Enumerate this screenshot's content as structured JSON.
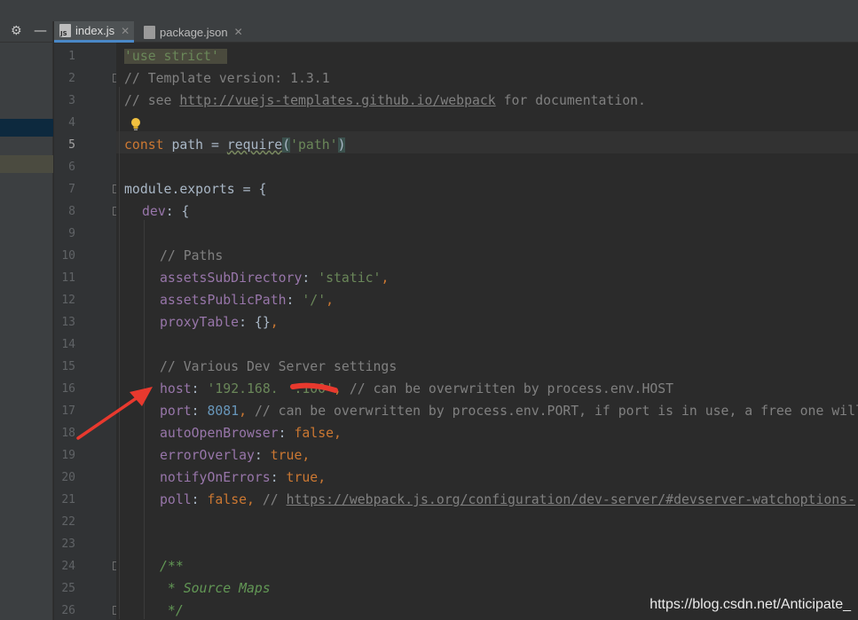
{
  "tabs": [
    {
      "label": "index.js",
      "active": true
    },
    {
      "label": "package.json",
      "active": false
    }
  ],
  "icons": {
    "settings": "gear-icon",
    "collapse": "minus-icon",
    "tab_close": "close-icon",
    "intention": "lightbulb-icon"
  },
  "gutter": {
    "line_numbers": [
      "1",
      "2",
      "3",
      "4",
      "5",
      "6",
      "7",
      "8",
      "9",
      "10",
      "11",
      "12",
      "13",
      "14",
      "15",
      "16",
      "17",
      "18",
      "19",
      "20",
      "21",
      "22",
      "23",
      "24",
      "25",
      "26"
    ],
    "current_line": 5
  },
  "code": {
    "l1": {
      "s": "'use strict'"
    },
    "l2": {
      "c": "// Template version: 1.3.1"
    },
    "l3": {
      "c1": "// see ",
      "url": "http://vuejs-templates.github.io/webpack",
      "c2": " for documentation."
    },
    "l5": {
      "kw": "const",
      "t1": " path = ",
      "fn": "require",
      "p1": "(",
      "s": "'path'",
      "p2": ")"
    },
    "l7": {
      "t": "module.exports = {"
    },
    "l8": {
      "f": "dev",
      "t": ": {"
    },
    "l10": {
      "c": "// Paths"
    },
    "l11": {
      "f": "assetsSubDirectory",
      "t": ": ",
      "s": "'static'",
      "k": ","
    },
    "l12": {
      "f": "assetsPublicPath",
      "t": ": ",
      "s": "'/'",
      "k": ","
    },
    "l13": {
      "f": "proxyTable",
      "t": ": {}",
      "k": ","
    },
    "l15": {
      "c": "// Various Dev Server settings"
    },
    "l16": {
      "f": "host",
      "t": ": ",
      "s": "'192.168.  .100'",
      "k": ",",
      "c": " // can be overwritten by process.env.HOST"
    },
    "l17": {
      "f": "port",
      "t": ": ",
      "n": "8081",
      "k": ",",
      "c": " // can be overwritten by process.env.PORT, if port is in use, a free one will be determined"
    },
    "l18": {
      "f": "autoOpenBrowser",
      "t": ": ",
      "b": "false",
      "k": ","
    },
    "l19": {
      "f": "errorOverlay",
      "t": ": ",
      "b": "true",
      "k": ","
    },
    "l20": {
      "f": "notifyOnErrors",
      "t": ": ",
      "b": "true",
      "k": ","
    },
    "l21": {
      "f": "poll",
      "t": ": ",
      "b": "false",
      "k": ",",
      "c": " // ",
      "url": "https://webpack.js.org/configuration/dev-server/#devserver-watchoptions-"
    },
    "l24": {
      "d": "/**"
    },
    "l25": {
      "d": " * Source Maps"
    },
    "l26": {
      "d": " */"
    }
  },
  "watermark": "https://blog.csdn.net/Anticipate_",
  "colors": {
    "background": "#2b2b2b",
    "gutter": "#313335",
    "panel": "#3c3f41",
    "string": "#6a8759",
    "keyword": "#cc7832",
    "field": "#9876aa",
    "number": "#6897bb",
    "comment": "#808080",
    "annotation": "#e8392e"
  }
}
